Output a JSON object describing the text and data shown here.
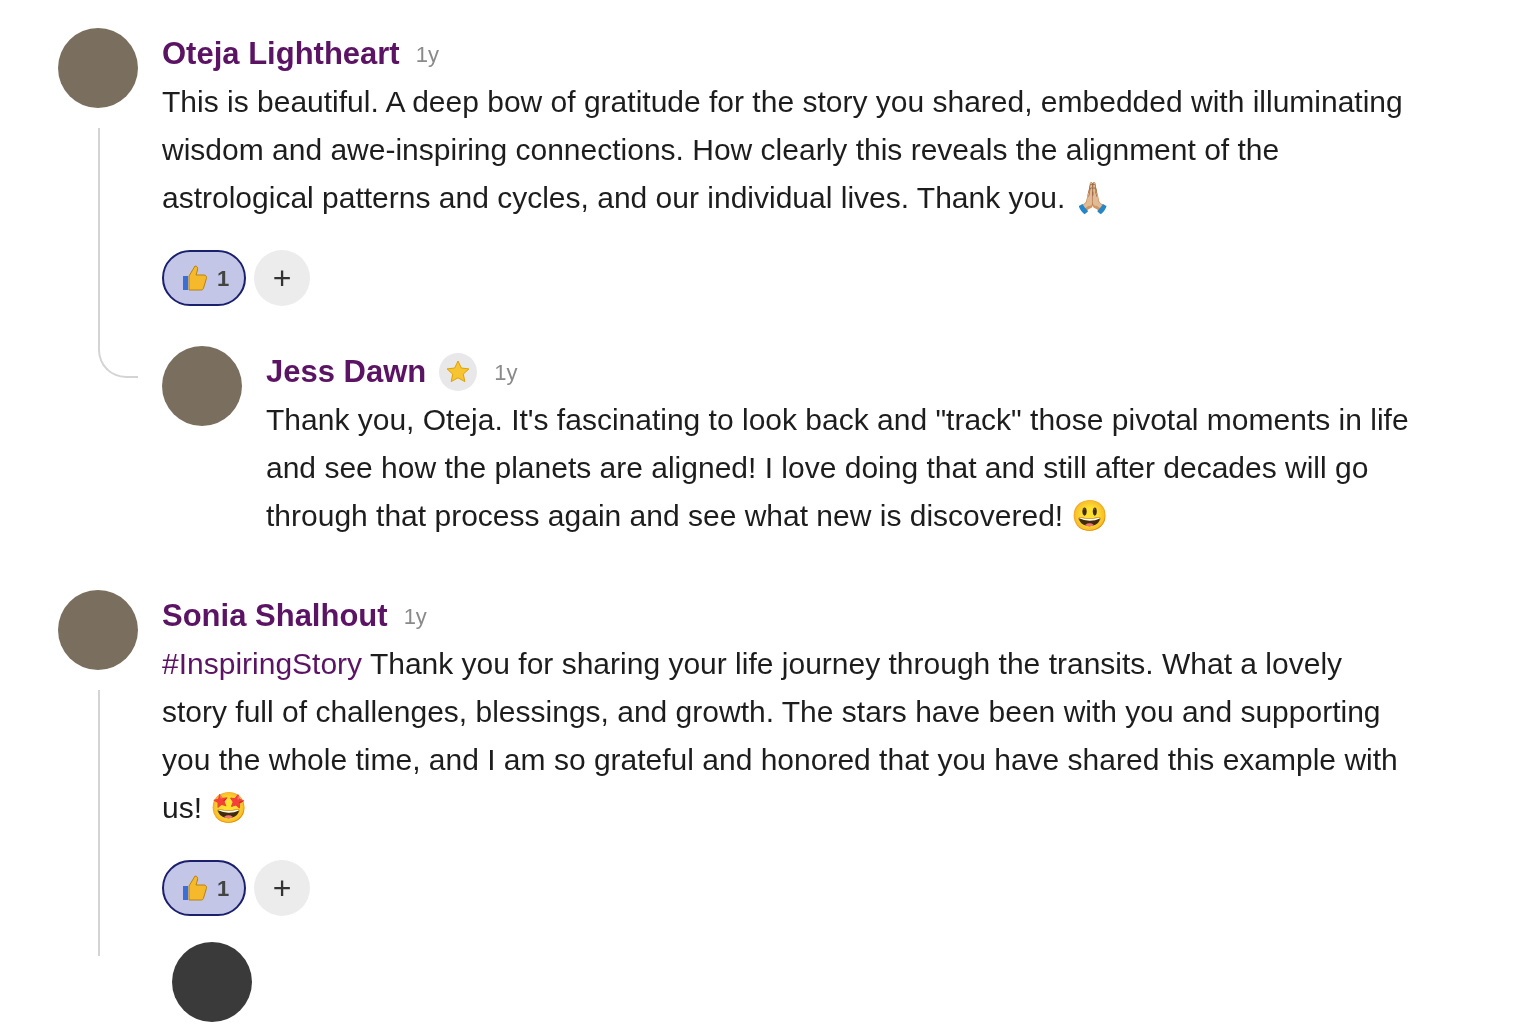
{
  "comments": [
    {
      "author": "Oteja Lightheart",
      "time": "1y",
      "body": [
        {
          "kind": "text",
          "text": "This is beautiful. A deep bow of gratitude for the story you shared, embedded with illuminating wisdom and awe-inspiring connections. How clearly this reveals the alignment of the astrological patterns and cycles, and our individual lives. Thank you. 🙏🏼"
        }
      ],
      "reactions": [
        {
          "kind": "thumbs-up",
          "count": "1",
          "selected": true
        }
      ],
      "add_reaction": "+",
      "replies": [
        {
          "author": "Jess Dawn",
          "starred": true,
          "time": "1y",
          "body": [
            {
              "kind": "text",
              "text": "Thank you, Oteja. It's fascinating to look back and \"track\" those pivotal moments in life and see how the planets are aligned! I love doing that and still after decades will go through that process again and see what new is discovered! 😃"
            }
          ]
        }
      ]
    },
    {
      "author": "Sonia Shalhout",
      "time": "1y",
      "body": [
        {
          "kind": "hashtag",
          "text": "#InspiringStory"
        },
        {
          "kind": "text",
          "text": "Thank you for sharing your life journey through the transits. What a lovely story full of challenges, blessings, and growth. The stars have been with you and supporting you the whole time, and I am so grateful and honored that you have shared this example with us! 🤩"
        }
      ],
      "reactions": [
        {
          "kind": "thumbs-up",
          "count": "1",
          "selected": true
        }
      ],
      "add_reaction": "+"
    }
  ]
}
